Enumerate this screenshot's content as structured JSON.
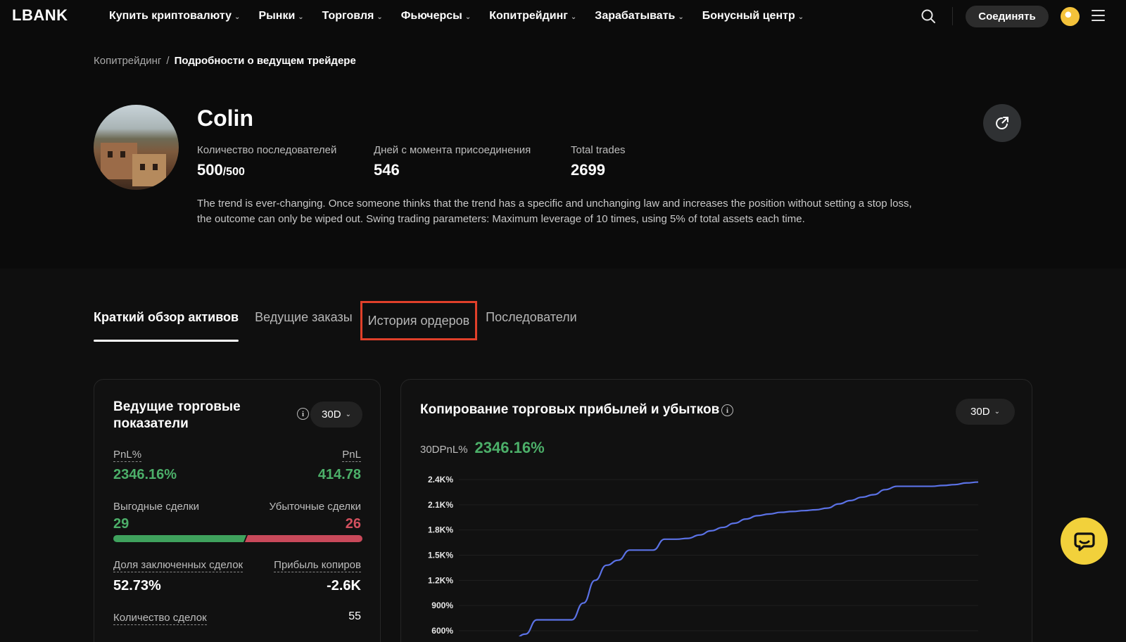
{
  "nav": {
    "logo": "LBANK",
    "menu": [
      {
        "label": "Купить криптовалюту"
      },
      {
        "label": "Рынки"
      },
      {
        "label": "Торговля"
      },
      {
        "label": "Фьючерсы"
      },
      {
        "label": "Копитрейдинг"
      },
      {
        "label": "Зарабатывать"
      },
      {
        "label": "Бонусный центр"
      }
    ],
    "connect_label": "Соединять"
  },
  "breadcrumb": {
    "parent": "Копитрейдинг",
    "separator": "/",
    "current": "Подробности о ведущем трейдере"
  },
  "profile": {
    "name": "Colin",
    "followers_label": "Количество последователей",
    "followers_value": "500",
    "followers_max": "/500",
    "days_label": "Дней с момента присоединения",
    "days_value": "546",
    "trades_label": "Total trades",
    "trades_value": "2699",
    "bio": "The trend is ever-changing. Once someone thinks that the trend has a specific and unchanging law and increases the position without setting a stop loss, the outcome can only be wiped out. Swing trading parameters: Maximum leverage of 10 times, using 5% of total assets each time."
  },
  "tabs": [
    {
      "label": "Краткий обзор активов",
      "active": true
    },
    {
      "label": "Ведущие заказы",
      "active": false
    },
    {
      "label": "История ордеров",
      "active": false,
      "highlighted": true
    },
    {
      "label": "Последователи",
      "active": false
    }
  ],
  "metrics": {
    "title": "Ведущие торговые показатели",
    "period": "30D",
    "pnl_pct_label": "PnL%",
    "pnl_pct_value": "2346.16%",
    "pnl_label": "PnL",
    "pnl_value": "414.78",
    "win_label": "Выгодные сделки",
    "win_value": "29",
    "loss_label": "Убыточные сделки",
    "loss_value": "26",
    "win_share": 0.527,
    "closed_ratio_label": "Доля заключенных сделок",
    "closed_ratio_value": "52.73%",
    "copier_profit_label": "Прибыль копиров",
    "copier_profit_value": "-2.6K",
    "trade_count_label": "Количество сделок",
    "trade_count_value": "55"
  },
  "pnl_card": {
    "title": "Копирование торговых прибылей и убытков",
    "period": "30D",
    "summary_label": "30DPnL%",
    "summary_value": "2346.16%"
  },
  "chart_data": {
    "type": "line",
    "title": "Копирование торговых прибылей и убытков",
    "y_ticks": [
      "600%",
      "900%",
      "1.2K%",
      "1.5K%",
      "1.8K%",
      "2.1K%",
      "2.4K%"
    ],
    "y_tick_values": [
      600,
      900,
      1200,
      1500,
      1800,
      2100,
      2400
    ],
    "ylim": [
      600,
      2400
    ],
    "grid": true,
    "series": [
      {
        "color": "#5b72e6",
        "x": [
          0,
          1,
          2,
          3,
          4,
          5,
          6,
          7,
          8,
          9,
          10,
          11,
          12,
          13,
          14,
          15,
          16,
          17,
          18,
          19,
          20,
          21,
          22,
          23,
          24,
          25,
          26,
          27,
          28,
          29,
          30,
          31,
          32,
          33,
          34,
          35,
          36,
          37,
          38,
          39,
          40
        ],
        "values": [
          500,
          560,
          730,
          730,
          730,
          730,
          930,
          1200,
          1380,
          1440,
          1560,
          1560,
          1560,
          1690,
          1690,
          1700,
          1740,
          1790,
          1830,
          1880,
          1930,
          1970,
          1990,
          2010,
          2020,
          2030,
          2040,
          2060,
          2110,
          2150,
          2190,
          2220,
          2280,
          2320,
          2320,
          2320,
          2320,
          2330,
          2340,
          2360,
          2370
        ]
      }
    ]
  },
  "colors": {
    "accent_green": "#4caf69",
    "accent_red": "#d2505e",
    "line": "#5b72e6",
    "highlight_box": "#e0402a",
    "chat": "#f2d13b"
  }
}
